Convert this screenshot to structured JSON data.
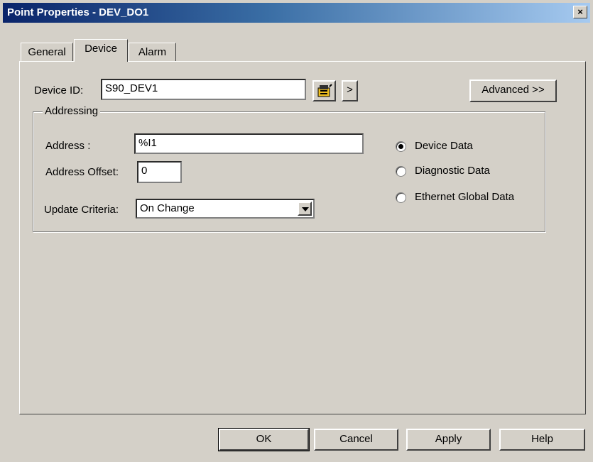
{
  "window": {
    "title": "Point Properties - DEV_DO1",
    "close_label": "×"
  },
  "tabs": [
    {
      "label": "General"
    },
    {
      "label": "Device"
    },
    {
      "label": "Alarm"
    }
  ],
  "device": {
    "device_id_label": "Device ID:",
    "device_id_value": "S90_DEV1",
    "browse_icon": "device-browse-icon",
    "arrow_label": ">",
    "advanced_label": "Advanced >>"
  },
  "addressing": {
    "legend": "Addressing",
    "address_label": "Address :",
    "address_value": "%I1",
    "offset_label": "Address Offset:",
    "offset_value": "0",
    "update_label": "Update Criteria:",
    "update_value": "On Change",
    "radio_options": [
      {
        "label": "Device Data",
        "selected": true
      },
      {
        "label": "Diagnostic Data",
        "selected": false
      },
      {
        "label": "Ethernet Global Data",
        "selected": false
      }
    ]
  },
  "buttons": {
    "ok": "OK",
    "cancel": "Cancel",
    "apply": "Apply",
    "help": "Help"
  }
}
